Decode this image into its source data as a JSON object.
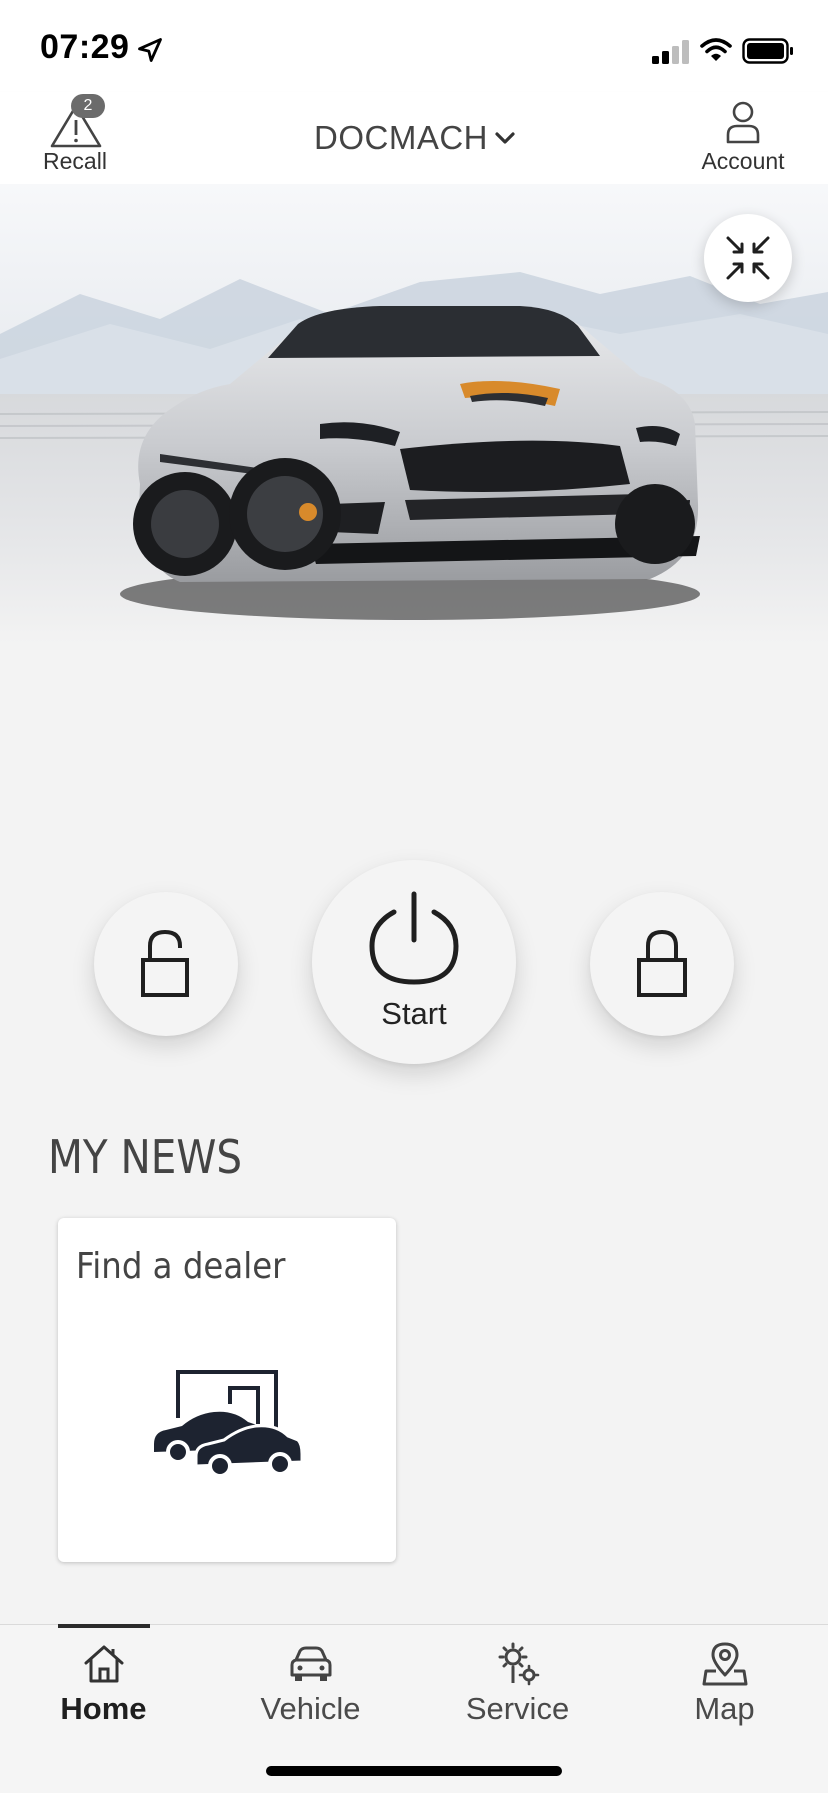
{
  "status_bar": {
    "time": "07:29",
    "icons": [
      "location-arrow-icon",
      "signal-icon",
      "wifi-icon",
      "battery-icon"
    ]
  },
  "header": {
    "recall": {
      "label": "Recall",
      "badge": "2",
      "icon": "warning-triangle-icon"
    },
    "vehicle_selector": {
      "name": "DOCMACH",
      "icon": "chevron-down-icon"
    },
    "account": {
      "label": "Account",
      "icon": "person-icon"
    }
  },
  "hero": {
    "collapse_icon": "collapse-arrows-icon"
  },
  "controls": {
    "unlock": {
      "icon": "unlock-icon"
    },
    "start": {
      "label": "Start",
      "icon": "power-icon"
    },
    "lock": {
      "icon": "lock-icon"
    }
  },
  "news": {
    "title": "MY NEWS",
    "cards": [
      {
        "title": "Find a dealer",
        "icon": "dealer-icon"
      }
    ]
  },
  "tab_bar": {
    "active": "Home",
    "tabs": [
      {
        "label": "Home",
        "icon": "home-icon"
      },
      {
        "label": "Vehicle",
        "icon": "car-icon"
      },
      {
        "label": "Service",
        "icon": "service-gears-icon"
      },
      {
        "label": "Map",
        "icon": "map-pin-icon"
      }
    ]
  },
  "colors": {
    "accent": "#2b2b2b",
    "background": "#f3f3f3",
    "card": "#ffffff",
    "car_stripe": "#d88a2b"
  }
}
